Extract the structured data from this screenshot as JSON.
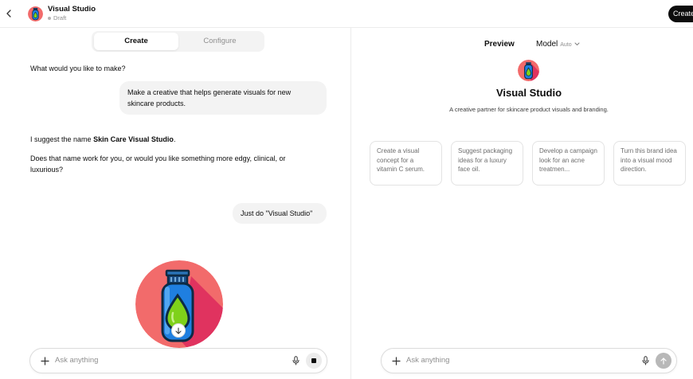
{
  "header": {
    "title": "Visual Studio",
    "status": "Draft",
    "create_button": "Create"
  },
  "tabs": {
    "create": "Create",
    "configure": "Configure"
  },
  "chat": {
    "messages": [
      {
        "role": "assistant",
        "text": "What would you like to make?"
      },
      {
        "role": "user",
        "text": "Make a creative that helps generate visuals for new skincare products."
      },
      {
        "role": "assistant",
        "prefix": "I suggest the name ",
        "bold": "Skin Care Visual Studio",
        "suffix": "."
      },
      {
        "role": "assistant",
        "text": "Does that name work for you, or would you like something more edgy, clinical, or luxurious?"
      },
      {
        "role": "user",
        "text": "Just do \"Visual Studio\""
      }
    ]
  },
  "composer_left": {
    "placeholder": "Ask anything"
  },
  "preview": {
    "label": "Preview",
    "model_label": "Model",
    "model_value": "Auto",
    "name": "Visual Studio",
    "description": "A creative partner for skincare product visuals and branding.",
    "starters": [
      "Create a visual concept for a vitamin C serum.",
      "Suggest packaging ideas for a luxury face oil.",
      "Develop a campaign look for an acne treatmen...",
      "Turn this brand idea into a visual mood direction."
    ]
  },
  "composer_right": {
    "placeholder": "Ask anything"
  },
  "colors": {
    "avatar_bg": "#f26b6b",
    "avatar_shadow": "#e0335f",
    "bottle": "#1f7fe0",
    "drop": "#7fd11a"
  },
  "icons": [
    "chevron-left-icon",
    "plus-icon",
    "microphone-icon",
    "stop-icon",
    "arrow-up-icon",
    "arrow-down-icon",
    "chevron-down-icon",
    "bottle-icon"
  ]
}
